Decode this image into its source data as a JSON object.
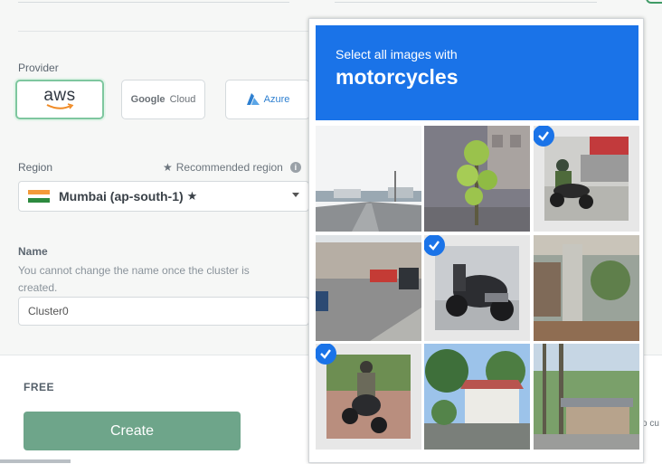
{
  "form": {
    "provider_label": "Provider",
    "providers": [
      {
        "name": "aws",
        "selected": true
      },
      {
        "name_prefix": "Google",
        "name_suffix": "Cloud",
        "selected": false
      },
      {
        "name": "Azure",
        "selected": false
      }
    ],
    "region_label": "Region",
    "recommended_label": "Recommended region",
    "region_value": "Mumbai (ap-south-1)",
    "region_star": "★",
    "name_label": "Name",
    "name_help": "You cannot change the name once the cluster is created.",
    "name_value": "Cluster0",
    "tier_label": "FREE",
    "create_label": "Create",
    "truncated_text": "o cu"
  },
  "captcha": {
    "prompt": "Select all images with",
    "target": "motorcycles",
    "accent_color": "#1a73e8",
    "tiles": [
      {
        "content": "street road",
        "selected": false
      },
      {
        "content": "tree",
        "selected": false
      },
      {
        "content": "motorcycle rider",
        "selected": true
      },
      {
        "content": "parking lot building",
        "selected": false
      },
      {
        "content": "parked scooter",
        "selected": true
      },
      {
        "content": "building pillar",
        "selected": false
      },
      {
        "content": "motorcycle rider",
        "selected": true
      },
      {
        "content": "houses trees",
        "selected": false
      },
      {
        "content": "street shed",
        "selected": false
      }
    ]
  },
  "colors": {
    "create_button": "#6ea58a",
    "selected_provider_border": "#7ec79f",
    "azure_blue": "#2d7fd0"
  }
}
